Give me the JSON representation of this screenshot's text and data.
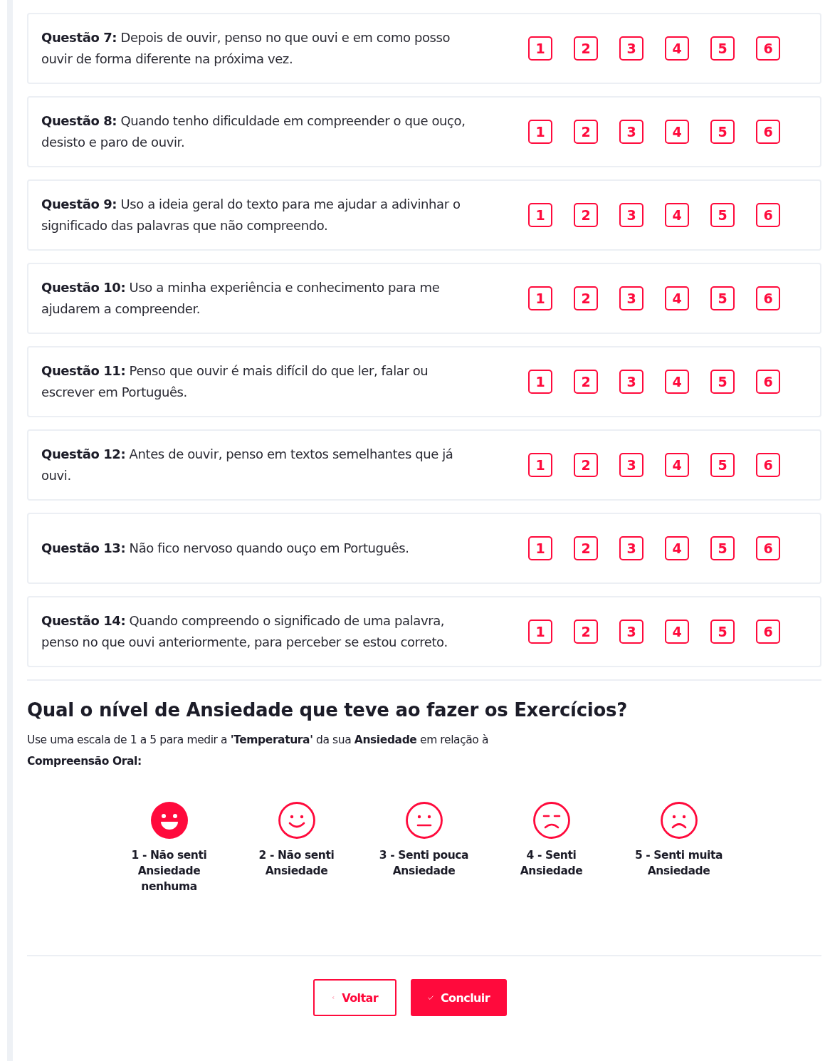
{
  "questions": [
    {
      "text": "**Questão 7:** Depois de ouvir, penso no que ouvi e em como posso ouvir de forma diferente na próxima vez.",
      "options": [
        {
          "label": "1",
          "selected": false
        },
        {
          "label": "2",
          "selected": false
        },
        {
          "label": "3",
          "selected": false
        },
        {
          "label": "4",
          "selected": false
        },
        {
          "label": "5",
          "selected": false
        },
        {
          "label": "6",
          "selected": false
        }
      ]
    },
    {
      "text": "**Questão 8:** Quando tenho dificuldade em compreender o que ouço, desisto e paro de ouvir.",
      "options": [
        {
          "label": "1",
          "selected": false
        },
        {
          "label": "2",
          "selected": false
        },
        {
          "label": "3",
          "selected": false
        },
        {
          "label": "4",
          "selected": false
        },
        {
          "label": "5",
          "selected": false
        },
        {
          "label": "6",
          "selected": false
        }
      ]
    },
    {
      "text": "**Questão 9:** Uso a ideia geral do texto para me ajudar a adivinhar o significado das palavras que não compreendo.",
      "options": [
        {
          "label": "1",
          "selected": false
        },
        {
          "label": "2",
          "selected": false
        },
        {
          "label": "3",
          "selected": false
        },
        {
          "label": "4",
          "selected": false
        },
        {
          "label": "5",
          "selected": false
        },
        {
          "label": "6",
          "selected": false
        }
      ]
    },
    {
      "text": "**Questão 10:** Uso a minha experiência e conhecimento para me ajudarem a compreender.",
      "options": [
        {
          "label": "1",
          "selected": false
        },
        {
          "label": "2",
          "selected": false
        },
        {
          "label": "3",
          "selected": false
        },
        {
          "label": "4",
          "selected": false
        },
        {
          "label": "5",
          "selected": false
        },
        {
          "label": "6",
          "selected": false
        }
      ]
    },
    {
      "text": "**Questão 11:** Penso que ouvir é mais difícil do que ler, falar ou escrever em Português.",
      "options": [
        {
          "label": "1",
          "selected": false
        },
        {
          "label": "2",
          "selected": false
        },
        {
          "label": "3",
          "selected": false
        },
        {
          "label": "4",
          "selected": false
        },
        {
          "label": "5",
          "selected": false
        },
        {
          "label": "6",
          "selected": false
        }
      ]
    },
    {
      "text": "**Questão 12:** Antes de ouvir, penso em textos semelhantes que já ouvi.",
      "options": [
        {
          "label": "1",
          "selected": false
        },
        {
          "label": "2",
          "selected": false
        },
        {
          "label": "3",
          "selected": false
        },
        {
          "label": "4",
          "selected": false
        },
        {
          "label": "5",
          "selected": false
        },
        {
          "label": "6",
          "selected": false
        }
      ]
    },
    {
      "text": "**Questão 13:** Não fico nervoso quando ouço em Português.",
      "options": [
        {
          "label": "1",
          "selected": false
        },
        {
          "label": "2",
          "selected": false
        },
        {
          "label": "3",
          "selected": false
        },
        {
          "label": "4",
          "selected": false
        },
        {
          "label": "5",
          "selected": false
        },
        {
          "label": "6",
          "selected": false
        }
      ]
    },
    {
      "text": "**Questão 14:** Quando compreendo o significado de uma palavra, penso no que ouvi anteriormente, para perceber se estou correto.",
      "options": [
        {
          "label": "1",
          "selected": false
        },
        {
          "label": "2",
          "selected": false
        },
        {
          "label": "3",
          "selected": false
        },
        {
          "label": "4",
          "selected": false
        },
        {
          "label": "5",
          "selected": false
        },
        {
          "label": "6",
          "selected": false
        }
      ]
    }
  ],
  "anxiety": {
    "title": "Qual o nível de Ansiedade que teve ao fazer os Exercícios?",
    "description": "Use uma escala de 1 a 5 para medir a **'Temperatura'** da sua **Ansiedade** em relação à",
    "description_2": "Compreensão Oral:",
    "levels": [
      {
        "kind": "laughing",
        "label": "1 - Não senti Ansiedade nenhuma",
        "selected": true
      },
      {
        "kind": "smile",
        "label": "2 - Não senti Ansiedade",
        "selected": false
      },
      {
        "kind": "neutral",
        "label": "3 - Senti pouca Ansiedade",
        "selected": false
      },
      {
        "kind": "sad",
        "label": "4 - Senti Ansiedade",
        "selected": false
      },
      {
        "kind": "frown",
        "label": "5 - Senti muita Ansiedade",
        "selected": false
      }
    ]
  },
  "buttons": {
    "back": "Voltar",
    "finish": "Concluir"
  }
}
